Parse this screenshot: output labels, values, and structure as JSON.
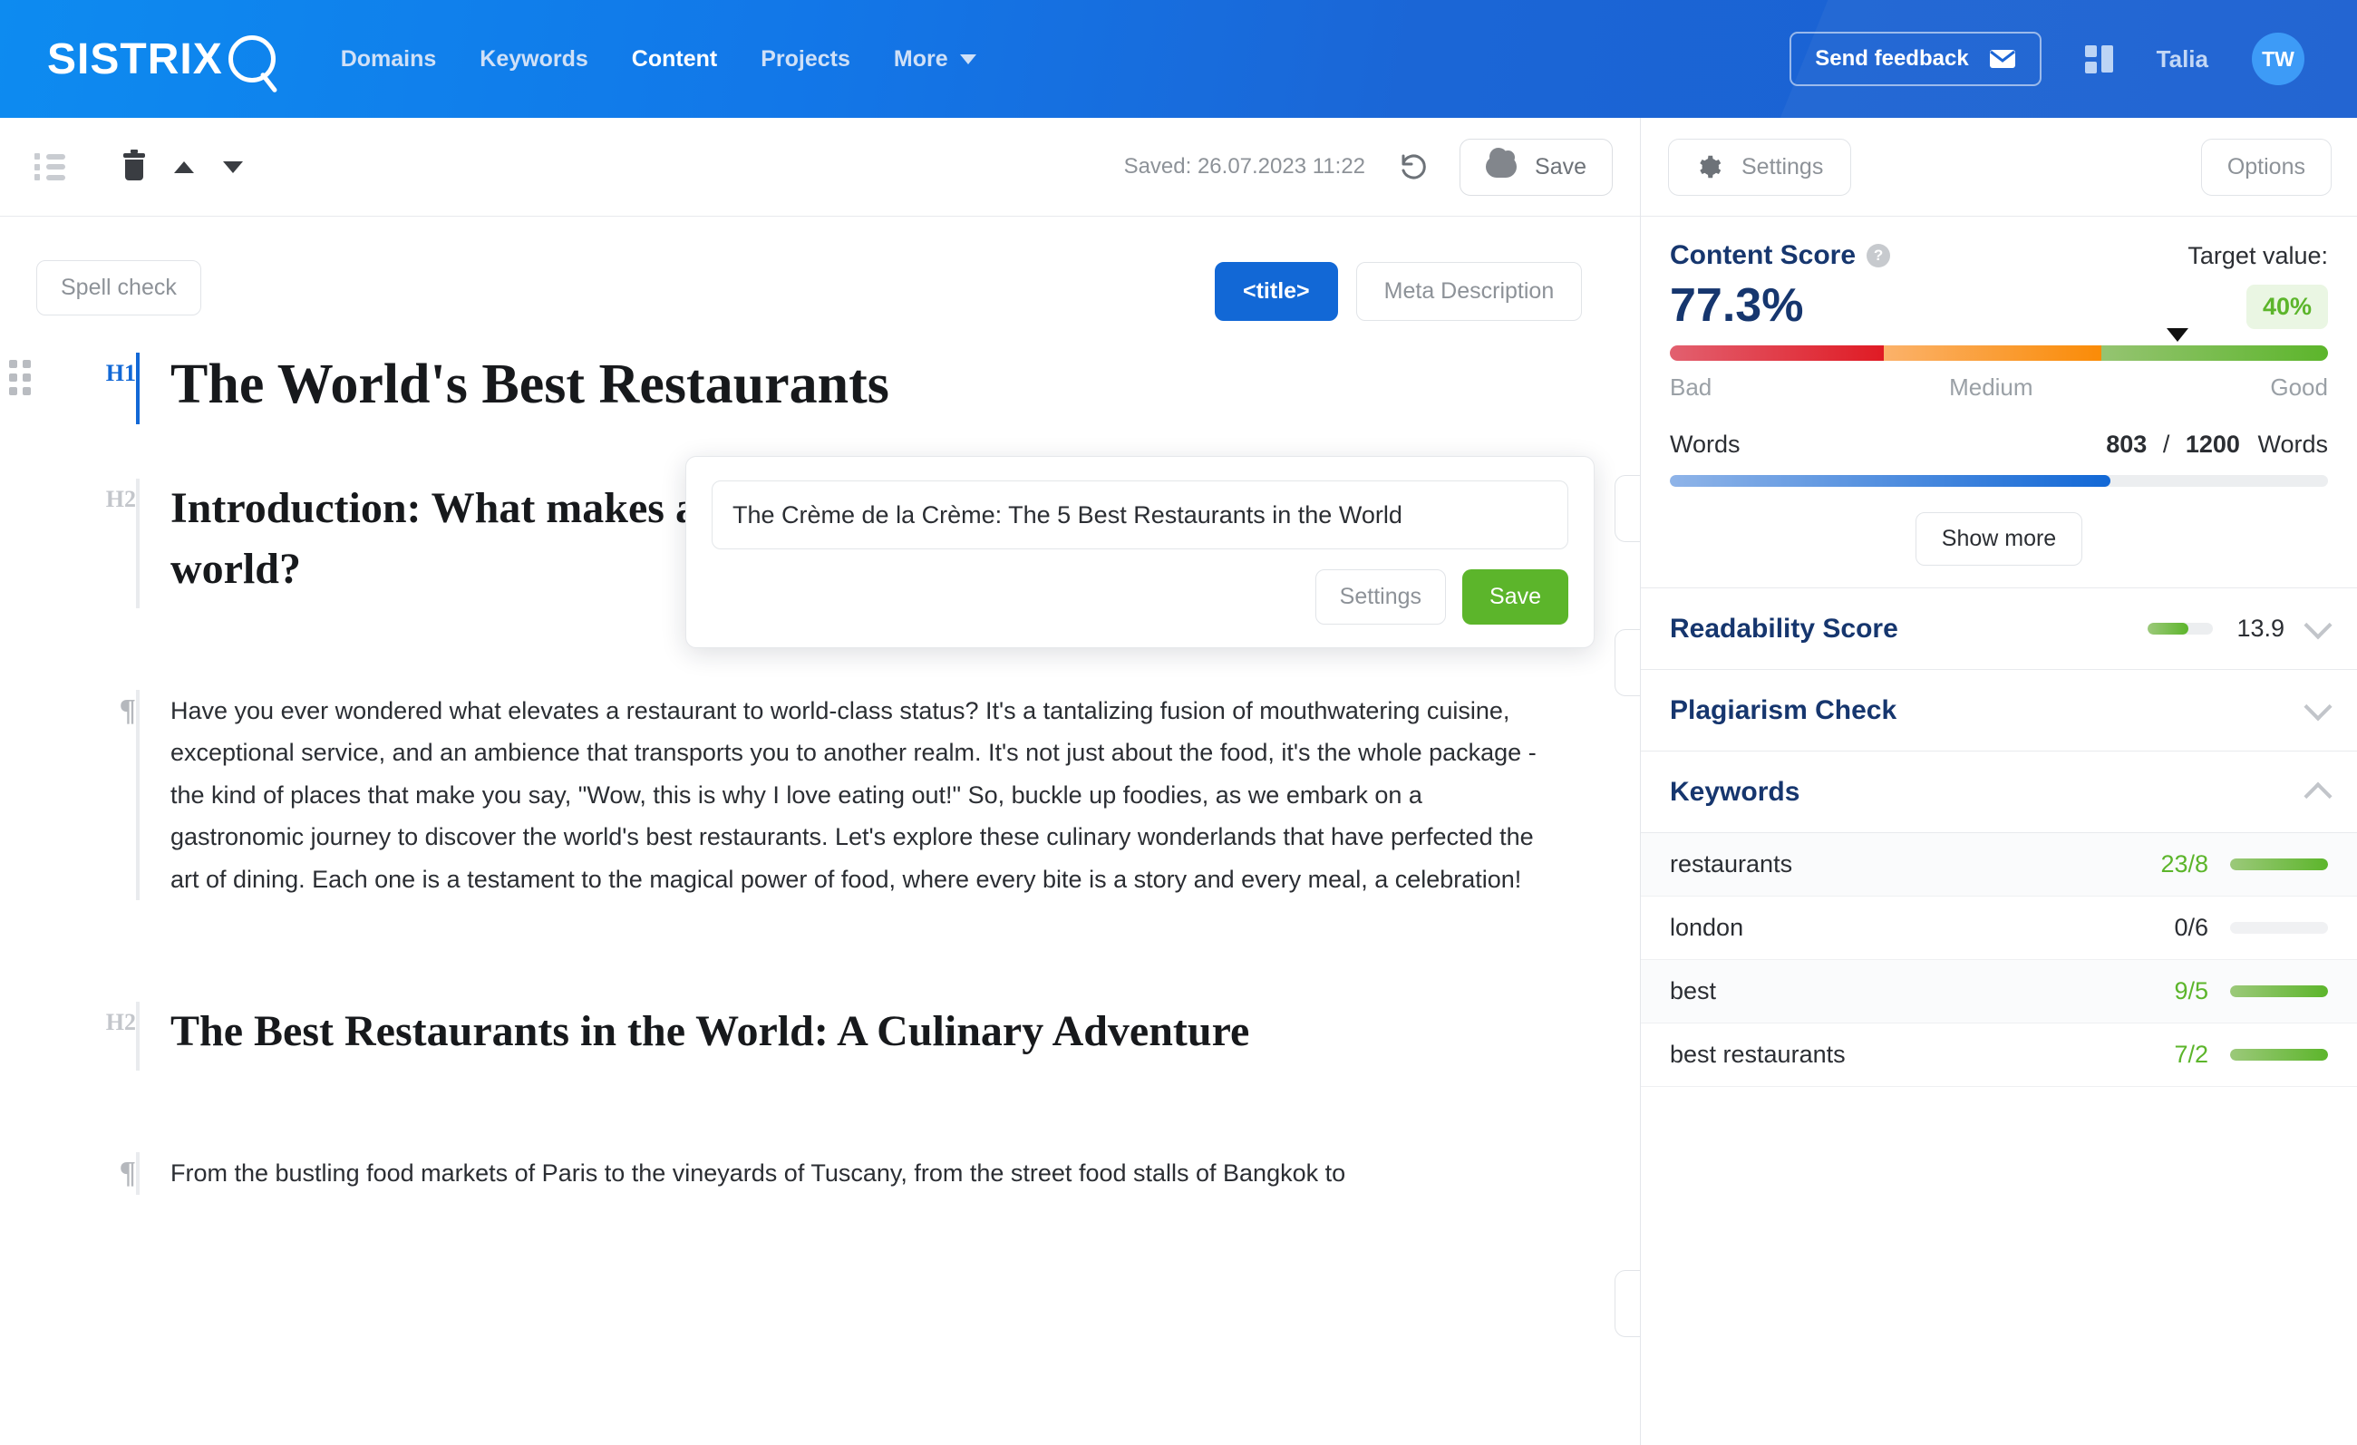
{
  "topnav": {
    "brand": "SISTRIX",
    "links": [
      {
        "label": "Domains",
        "active": false
      },
      {
        "label": "Keywords",
        "active": false
      },
      {
        "label": "Content",
        "active": true
      },
      {
        "label": "Projects",
        "active": false
      },
      {
        "label": "More",
        "active": false
      }
    ],
    "feedback_label": "Send feedback",
    "user_name": "Talia",
    "avatar_initials": "TW"
  },
  "editor_toolbar": {
    "saved_text": "Saved: 26.07.2023 11:22",
    "save_label": "Save"
  },
  "editor": {
    "spellcheck_label": "Spell check",
    "seo_tabs": [
      {
        "label": "<title>",
        "active": true
      },
      {
        "label": "Meta Description",
        "active": false
      }
    ],
    "blocks": [
      {
        "tag": "H1",
        "type": "h1",
        "text": "The World's Best Restaurants"
      },
      {
        "tag": "H2",
        "type": "h2",
        "text": "Introduction: What makes a restaurant the best restaurant in the world?"
      },
      {
        "tag": "¶",
        "type": "p",
        "text": "Have you ever wondered what elevates a restaurant to world-class status? It's a tantalizing fusion of mouthwatering cuisine, exceptional service, and an ambience that transports you to another realm. It's not just about the food, it's the whole package - the kind of places that make you say, \"Wow, this is why I love eating out!\" So, buckle up foodies, as we embark on a gastronomic journey to discover the world's best restaurants. Let's explore these culinary wonderlands that have perfected the art of dining. Each one is a testament to the magical power of food, where every bite is a story and every meal, a celebration!"
      },
      {
        "tag": "H2",
        "type": "h2",
        "text": "The Best Restaurants in the World: A Culinary Adventure"
      },
      {
        "tag": "¶",
        "type": "p",
        "text": "From the bustling food markets of Paris to the vineyards of Tuscany, from the street food stalls of Bangkok to"
      }
    ]
  },
  "title_popup": {
    "input_value": "The Crème de la Crème: The 5 Best Restaurants in the World",
    "input_placeholder": "Title",
    "settings_label": "Settings",
    "save_label": "Save"
  },
  "panel": {
    "settings_label": "Settings",
    "options_label": "Options",
    "content_score": {
      "title": "Content Score",
      "target_label": "Target value:",
      "value": "77.3%",
      "target_badge": "40%",
      "marker_percent": 75.5,
      "scale_labels": [
        "Bad",
        "Medium",
        "Good"
      ]
    },
    "words": {
      "label": "Words",
      "current": "803",
      "separator": "/",
      "target": "1200",
      "unit": "Words",
      "progress_percent": 67,
      "show_more_label": "Show more"
    },
    "accordions": [
      {
        "title": "Readability Score",
        "value": "13.9",
        "bar_percent": 62,
        "has_bar": true,
        "expanded": false
      },
      {
        "title": "Plagiarism Check",
        "value": "",
        "bar_percent": 0,
        "has_bar": false,
        "expanded": false
      },
      {
        "title": "Keywords",
        "value": "",
        "bar_percent": 0,
        "has_bar": false,
        "expanded": true
      }
    ],
    "keywords": [
      {
        "name": "restaurants",
        "count": "23/8",
        "state": "ok",
        "bar_percent": 100
      },
      {
        "name": "london",
        "count": "0/6",
        "state": "zero",
        "bar_percent": 0
      },
      {
        "name": "best",
        "count": "9/5",
        "state": "ok",
        "bar_percent": 100
      },
      {
        "name": "best restaurants",
        "count": "7/2",
        "state": "ok",
        "bar_percent": 100
      }
    ]
  }
}
